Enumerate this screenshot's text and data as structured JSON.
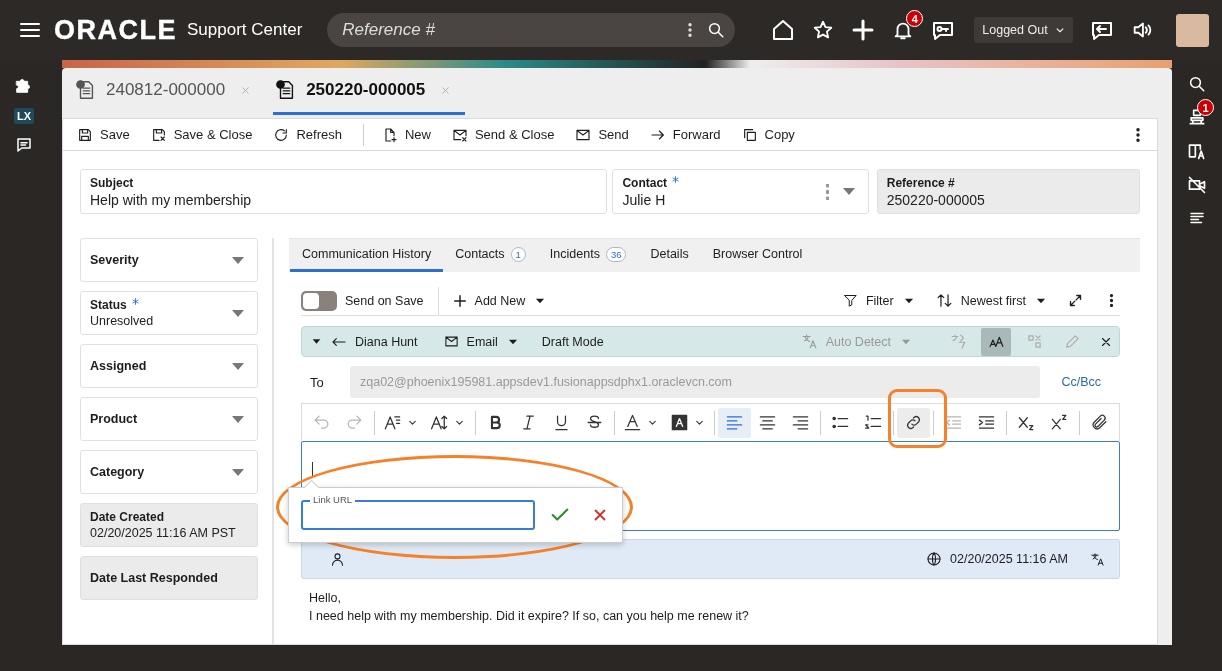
{
  "header": {
    "logo": "ORACLE",
    "app_title": "Support Center",
    "search_placeholder": "Reference #",
    "notification_count": "4",
    "status_select": "Logged Out"
  },
  "left_rail": {
    "tag": "LX"
  },
  "right_rail": {
    "notification_count": "1"
  },
  "record_tabs": [
    {
      "label": "240812-000000",
      "selected": false
    },
    {
      "label": "250220-000005",
      "selected": true
    }
  ],
  "toolbar": [
    {
      "label": "Save",
      "separator_before": false
    },
    {
      "label": "Save & Close",
      "separator_before": false
    },
    {
      "label": "Refresh",
      "separator_before": false
    },
    {
      "label": "New",
      "separator_before": true
    },
    {
      "label": "Send & Close",
      "separator_before": false
    },
    {
      "label": "Send",
      "separator_before": false
    },
    {
      "label": "Forward",
      "separator_before": false
    },
    {
      "label": "Copy",
      "separator_before": false
    }
  ],
  "case_header": [
    {
      "label": "Subject",
      "value": "Help with my membership",
      "required": false,
      "kind": "text"
    },
    {
      "label": "Contact",
      "value": "Julie H",
      "required": true,
      "kind": "lookup"
    },
    {
      "label": "Reference #",
      "value": "250220-000005",
      "required": false,
      "kind": "readonly"
    }
  ],
  "case_fields": [
    {
      "label": "Severity",
      "required": false,
      "kind": "select"
    },
    {
      "label": "Status",
      "value": "Unresolved",
      "required": true,
      "kind": "select"
    },
    {
      "label": "Assigned",
      "required": false,
      "kind": "select"
    },
    {
      "label": "Product",
      "required": false,
      "kind": "select"
    },
    {
      "label": "Category",
      "required": false,
      "kind": "select"
    },
    {
      "label": "Date Created",
      "value": "02/20/2025 11:16 AM PST",
      "required": false,
      "kind": "readonly"
    },
    {
      "label": "Date Last Responded",
      "required": false,
      "kind": "readonly"
    }
  ],
  "subtabs": [
    {
      "label": "Communication History",
      "selected": true
    },
    {
      "label": "Contacts",
      "count": "1",
      "selected": false
    },
    {
      "label": "Incidents",
      "count": "36",
      "selected": false
    },
    {
      "label": "Details",
      "selected": false
    },
    {
      "label": "Browser Control",
      "selected": false
    }
  ],
  "communication": {
    "send_on_save": {
      "label": "Send on Save",
      "on": false
    },
    "add_new": "Add New",
    "filter": "Filter",
    "sort": "Newest first",
    "draft": {
      "sender": "Diana Hunt",
      "channel": "Email",
      "mode": "Draft Mode",
      "language": {
        "value": "Auto Detect",
        "disabled": true
      },
      "tools": [
        {
          "selected": false,
          "disabled": true
        },
        {
          "selected": true,
          "disabled": false
        },
        {
          "selected": false,
          "disabled": true
        },
        {
          "selected": false,
          "disabled": true
        }
      ]
    },
    "to": {
      "label": "To",
      "value": "zqa02@phoenix195981.appsdev1.fusionappsdphx1.oraclevcn.com",
      "cc_bcc": "Cc/Bcc"
    },
    "editor_groups": [
      [
        {
          "kind": "undo",
          "selected": false,
          "disabled": true
        },
        {
          "kind": "redo",
          "selected": false,
          "disabled": true
        }
      ],
      [
        {
          "kind": "font-style",
          "selected": false,
          "disabled": false
        },
        {
          "kind": "font-size",
          "selected": false,
          "disabled": false
        }
      ],
      [
        {
          "kind": "bold",
          "selected": false,
          "disabled": false
        },
        {
          "kind": "italic",
          "selected": false,
          "disabled": false
        },
        {
          "kind": "underline",
          "selected": false,
          "disabled": false
        },
        {
          "kind": "strike",
          "selected": false,
          "disabled": false
        }
      ],
      [
        {
          "kind": "text-color",
          "selected": false,
          "disabled": false
        },
        {
          "kind": "highlight",
          "selected": false,
          "disabled": false
        }
      ],
      [
        {
          "kind": "align-left",
          "selected": true,
          "disabled": false
        },
        {
          "kind": "align-center",
          "selected": false,
          "disabled": false
        },
        {
          "kind": "align-right",
          "selected": false,
          "disabled": false
        }
      ],
      [
        {
          "kind": "bullets",
          "selected": false,
          "disabled": false
        },
        {
          "kind": "numbering",
          "selected": false,
          "disabled": false
        }
      ],
      [
        {
          "kind": "link",
          "selected": true,
          "disabled": false
        }
      ],
      [
        {
          "kind": "outdent",
          "selected": false,
          "disabled": true
        },
        {
          "kind": "indent",
          "selected": false,
          "disabled": false
        }
      ],
      [
        {
          "kind": "subscript",
          "selected": false,
          "disabled": false
        },
        {
          "kind": "superscript",
          "selected": false,
          "disabled": false
        }
      ],
      [
        {
          "kind": "attach",
          "selected": false,
          "disabled": false
        }
      ]
    ],
    "link_popup": {
      "label": "Link URL"
    },
    "message": {
      "timestamp": "02/20/2025 11:16 AM",
      "body": [
        "Hello,",
        "I need help with my membership. Did it expire? If so, can you help me renew it?"
      ]
    }
  },
  "annotation_marks": [
    {
      "kind": "ellipse"
    },
    {
      "kind": "box"
    }
  ]
}
